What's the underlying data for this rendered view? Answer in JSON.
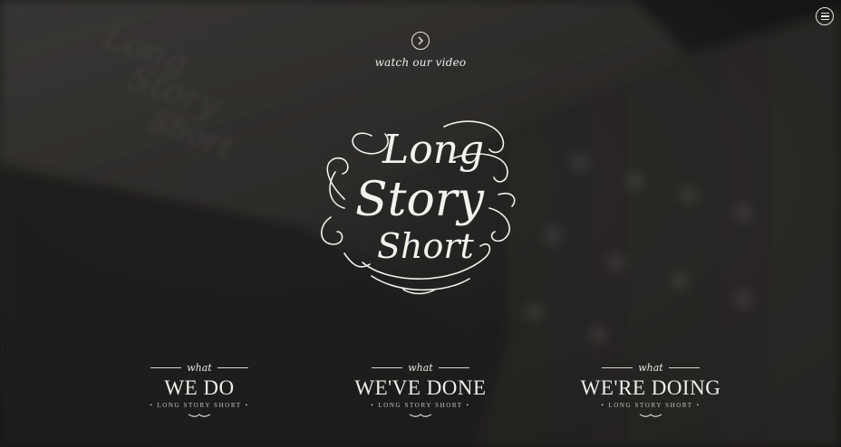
{
  "video": {
    "play_icon": "chevron-right-icon",
    "label": "watch our video"
  },
  "menu": {
    "icon": "hamburger-menu-icon"
  },
  "logo": {
    "line1": "Long",
    "line2": "Story",
    "line3": "Short"
  },
  "sections": [
    {
      "what": "what",
      "title": "WE DO",
      "subtitle": "LONG STORY SHORT"
    },
    {
      "what": "what",
      "title": "WE'VE DONE",
      "subtitle": "LONG STORY SHORT"
    },
    {
      "what": "what",
      "title": "WE'RE DOING",
      "subtitle": "LONG STORY SHORT"
    }
  ],
  "colors": {
    "text": "#f0eee9",
    "background": "#1c1b1a"
  }
}
